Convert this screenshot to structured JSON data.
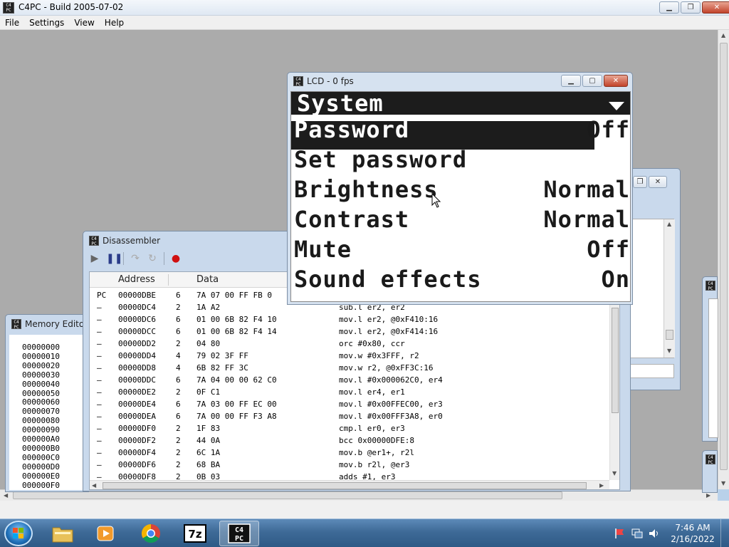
{
  "main_window": {
    "title": "C4PC - Build 2005-07-02",
    "menu": [
      "File",
      "Settings",
      "View",
      "Help"
    ]
  },
  "memory_editor": {
    "title": "Memory Editor",
    "addresses": [
      "00000000",
      "00000010",
      "00000020",
      "00000030",
      "00000040",
      "00000050",
      "00000060",
      "00000070",
      "00000080",
      "00000090",
      "000000A0",
      "000000B0",
      "000000C0",
      "000000D0",
      "000000E0",
      "000000F0"
    ]
  },
  "disassembler": {
    "title": "Disassembler",
    "columns": {
      "address": "Address",
      "data": "Data"
    },
    "rows": [
      {
        "marker": "PC",
        "addr": "00000DBE",
        "len": "6",
        "bytes": "7A 07 00 FF FB 0",
        "instr": ""
      },
      {
        "marker": "–",
        "addr": "00000DC4",
        "len": "2",
        "bytes": "1A A2",
        "instr": "sub.l er2, er2"
      },
      {
        "marker": "–",
        "addr": "00000DC6",
        "len": "6",
        "bytes": "01 00 6B 82 F4 10",
        "instr": "mov.l er2, @0xF410:16"
      },
      {
        "marker": "–",
        "addr": "00000DCC",
        "len": "6",
        "bytes": "01 00 6B 82 F4 14",
        "instr": "mov.l er2, @0xF414:16"
      },
      {
        "marker": "–",
        "addr": "00000DD2",
        "len": "2",
        "bytes": "04 80",
        "instr": "orc #0x80, ccr"
      },
      {
        "marker": "–",
        "addr": "00000DD4",
        "len": "4",
        "bytes": "79 02 3F FF",
        "instr": "mov.w #0x3FFF, r2"
      },
      {
        "marker": "–",
        "addr": "00000DD8",
        "len": "4",
        "bytes": "6B 82 FF 3C",
        "instr": "mov.w r2, @0xFF3C:16"
      },
      {
        "marker": "–",
        "addr": "00000DDC",
        "len": "6",
        "bytes": "7A 04 00 00 62 C0",
        "instr": "mov.l #0x000062C0, er4"
      },
      {
        "marker": "–",
        "addr": "00000DE2",
        "len": "2",
        "bytes": "0F C1",
        "instr": "mov.l er4, er1"
      },
      {
        "marker": "–",
        "addr": "00000DE4",
        "len": "6",
        "bytes": "7A 03 00 FF EC 00",
        "instr": "mov.l #0x00FFEC00, er3"
      },
      {
        "marker": "–",
        "addr": "00000DEA",
        "len": "6",
        "bytes": "7A 00 00 FF F3 A8",
        "instr": "mov.l #0x00FFF3A8, er0"
      },
      {
        "marker": "–",
        "addr": "00000DF0",
        "len": "2",
        "bytes": "1F 83",
        "instr": "cmp.l er0, er3"
      },
      {
        "marker": "–",
        "addr": "00000DF2",
        "len": "2",
        "bytes": "44 0A",
        "instr": "bcc 0x00000DFE:8"
      },
      {
        "marker": "–",
        "addr": "00000DF4",
        "len": "2",
        "bytes": "6C 1A",
        "instr": "mov.b @er1+, r2l"
      },
      {
        "marker": "–",
        "addr": "00000DF6",
        "len": "2",
        "bytes": "68 BA",
        "instr": "mov.b r2l, @er3"
      },
      {
        "marker": "–",
        "addr": "00000DF8",
        "len": "2",
        "bytes": "0B 03",
        "instr": "adds #1, er3"
      }
    ]
  },
  "lcd": {
    "title": "LCD - 0 fps",
    "header": "System",
    "items": [
      {
        "label": "Password",
        "value": "Off",
        "selected": true
      },
      {
        "label": "Set password",
        "value": "",
        "selected": false
      },
      {
        "label": "Brightness",
        "value": "Normal",
        "selected": false
      },
      {
        "label": "Contrast",
        "value": "Normal",
        "selected": false
      },
      {
        "label": "Mute",
        "value": "Off",
        "selected": false
      },
      {
        "label": "Sound effects",
        "value": "On",
        "selected": false
      }
    ]
  },
  "taskbar": {
    "apps": [
      "file-explorer",
      "media-player",
      "chrome",
      "7zip",
      "c4pc"
    ],
    "clock_time": "7:46 AM",
    "clock_date": "2/16/2022"
  },
  "colors": {
    "lcd_dark": "#1c1c1c",
    "window_frame": "#c9d9ec",
    "mdi_background": "#ababab"
  }
}
